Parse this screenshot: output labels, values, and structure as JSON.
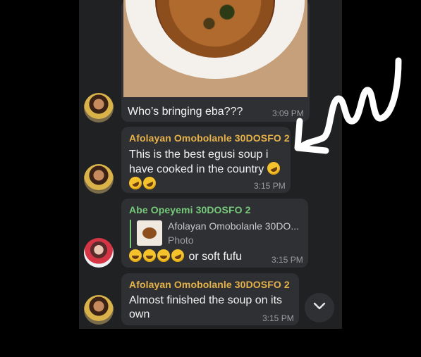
{
  "messages": [
    {
      "text": "Who’s bringing eba???",
      "time": "3:09 PM"
    },
    {
      "sender": "Afolayan Omobolanle 30DOSFO 2",
      "line1": "This is the best egusi soup i",
      "line2": "have cooked in the country",
      "time": "3:15 PM"
    },
    {
      "sender": "Abe Opeyemi 30DOSFO 2",
      "reply_name": "Afolayan Omobolanle 30DO...",
      "reply_sub": "Photo",
      "text": "or soft fufu",
      "time": "3:15 PM"
    },
    {
      "sender": "Afolayan Omobolanle 30DOSFO 2",
      "line1": "Almost finished the soup on its",
      "line2": "own",
      "time": "3:15 PM"
    }
  ],
  "icons": {
    "scroll_down": "chevron-down-icon",
    "annotation": "arrow-icon",
    "laugh_emoji": "rolling-laughing-emoji-icon",
    "smile_emoji": "grinning-emoji-icon"
  },
  "colors": {
    "background": "#000000",
    "chat_bg": "#202123",
    "bubble": "#2f3033",
    "sender_orange": "#e5b24a",
    "sender_green": "#75c97a"
  }
}
